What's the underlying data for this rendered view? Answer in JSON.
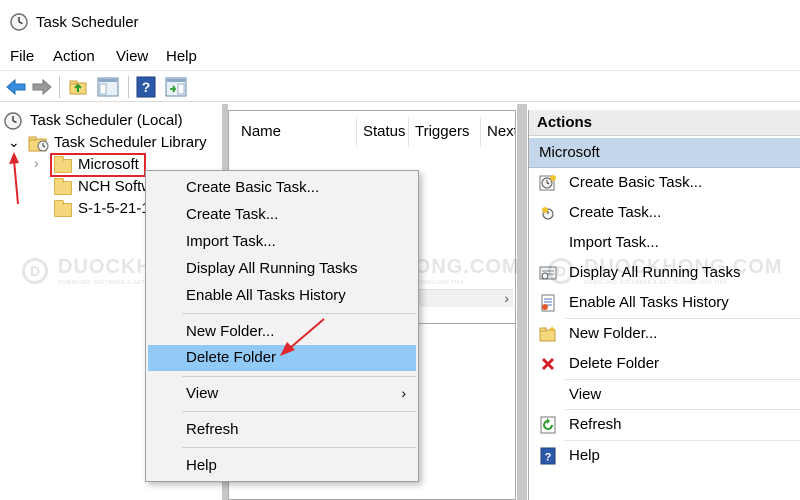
{
  "window": {
    "title": "Task Scheduler"
  },
  "menu": {
    "items": [
      "File",
      "Action",
      "View",
      "Help"
    ]
  },
  "tree": {
    "root": "Task Scheduler (Local)",
    "library": "Task Scheduler Library",
    "folders": [
      "Microsoft",
      "NCH Softw",
      "S-1-5-21-1"
    ]
  },
  "list": {
    "columns": [
      "Name",
      "Status",
      "Triggers",
      "Next"
    ]
  },
  "actions": {
    "header": "Actions",
    "section": "Microsoft",
    "items": [
      {
        "label": "Create Basic Task...",
        "icon": "create-basic-task-icon"
      },
      {
        "label": "Create Task...",
        "icon": "create-task-icon"
      },
      {
        "label": "Import Task...",
        "icon": ""
      },
      {
        "label": "Display All Running Tasks",
        "icon": "running-tasks-icon"
      },
      {
        "label": "Enable All Tasks History",
        "icon": "tasks-history-icon"
      },
      {
        "label": "New Folder...",
        "icon": "new-folder-icon"
      },
      {
        "label": "Delete Folder",
        "icon": "delete-icon"
      },
      {
        "label": "View",
        "icon": ""
      },
      {
        "label": "Refresh",
        "icon": "refresh-icon"
      },
      {
        "label": "Help",
        "icon": "help-icon"
      }
    ]
  },
  "context_menu": {
    "items": [
      "Create Basic Task...",
      "Create Task...",
      "Import Task...",
      "Display All Running Tasks",
      "Enable All Tasks History",
      "New Folder...",
      "Delete Folder",
      "View",
      "Refresh",
      "Help"
    ],
    "highlighted": "Delete Folder",
    "submenu_arrow": "›"
  },
  "watermark": {
    "logo": "D",
    "text": "DUOCKHONG.COM",
    "subtext": "DOWNLOAD SOFTWARE & GET TECHNOLOGY TIPS"
  },
  "colors": {
    "highlight": "#91c9f7",
    "actions_section": "#c4d6ea",
    "annotation_red": "#e0262d",
    "folder": "#f5d77e"
  }
}
